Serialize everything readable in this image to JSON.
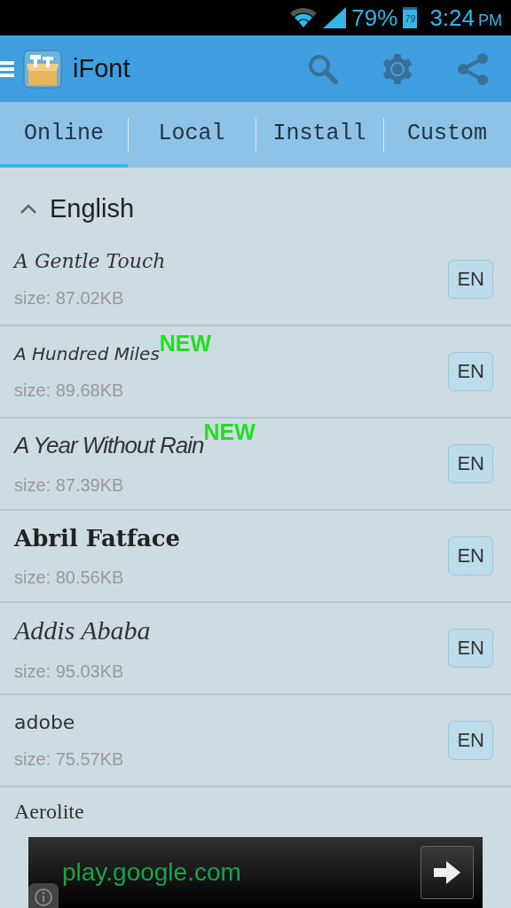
{
  "status_bar": {
    "battery": "79%",
    "battery_icon_text": "79",
    "time": "3:24",
    "ampm": "PM"
  },
  "app_bar": {
    "title": "iFont"
  },
  "tabs": [
    {
      "label": "Online",
      "selected": true
    },
    {
      "label": "Local",
      "selected": false
    },
    {
      "label": "Install",
      "selected": false
    },
    {
      "label": "Custom",
      "selected": false
    }
  ],
  "section": {
    "title": "English",
    "expanded": true
  },
  "fonts": [
    {
      "name": "A Gentle Touch",
      "kind": "script",
      "size": "size: 87.02KB",
      "lang": "EN"
    },
    {
      "name": "A Hundred Miles",
      "kind": "hand",
      "badge": "NEW",
      "size": "size: 89.68KB",
      "lang": "EN"
    },
    {
      "name": "A Year Without Rain",
      "kind": "marker",
      "badge": "NEW",
      "size": "size: 87.39KB",
      "lang": "EN"
    },
    {
      "name": "Abril Fatface",
      "kind": "display",
      "size": "size: 80.56KB",
      "lang": "EN"
    },
    {
      "name": "Addis Ababa",
      "kind": "italic",
      "size": "size: 95.03KB",
      "lang": "EN"
    },
    {
      "name": "adobe",
      "kind": "rounded",
      "size": "size: 75.57KB",
      "lang": "EN"
    },
    {
      "name": "Aerolite",
      "kind": "thin"
    }
  ],
  "ad": {
    "text": "play.google.com"
  }
}
